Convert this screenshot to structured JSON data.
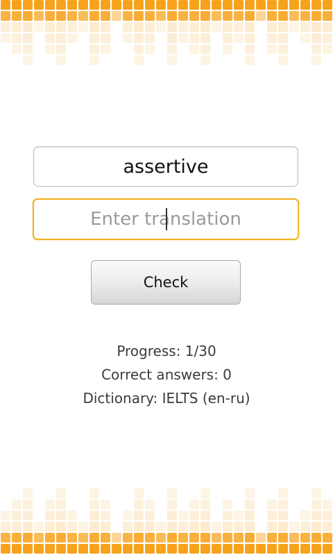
{
  "word": "assertive",
  "translation": {
    "value": "",
    "placeholder": "Enter translation"
  },
  "check_label": "Check",
  "stats": {
    "progress": "Progress: 1/30",
    "correct": "Correct answers: 0",
    "dictionary": "Dictionary: IELTS (en-ru)"
  },
  "colors": {
    "accent": "#f0b323",
    "equalizer_bright": "#f7a21b",
    "equalizer_light": "#fbe6c2"
  }
}
